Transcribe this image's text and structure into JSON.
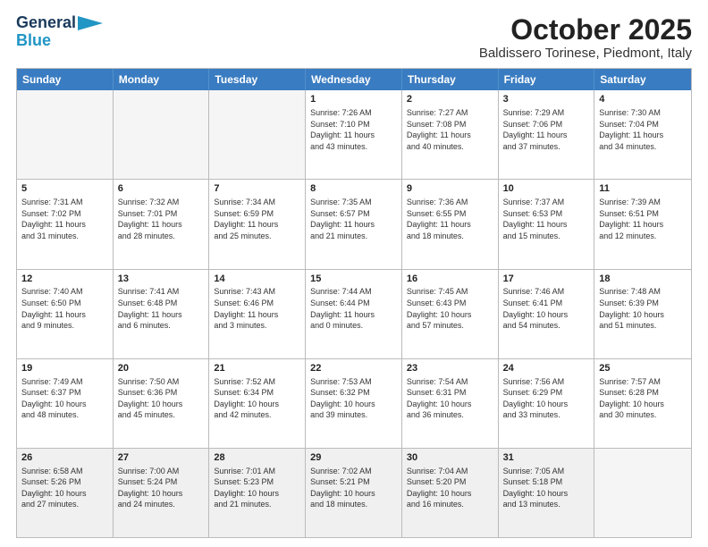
{
  "logo": {
    "general": "General",
    "blue": "Blue"
  },
  "header": {
    "month": "October 2025",
    "location": "Baldissero Torinese, Piedmont, Italy"
  },
  "days": [
    "Sunday",
    "Monday",
    "Tuesday",
    "Wednesday",
    "Thursday",
    "Friday",
    "Saturday"
  ],
  "weeks": [
    [
      {
        "day": "",
        "info": ""
      },
      {
        "day": "",
        "info": ""
      },
      {
        "day": "",
        "info": ""
      },
      {
        "day": "1",
        "info": "Sunrise: 7:26 AM\nSunset: 7:10 PM\nDaylight: 11 hours\nand 43 minutes."
      },
      {
        "day": "2",
        "info": "Sunrise: 7:27 AM\nSunset: 7:08 PM\nDaylight: 11 hours\nand 40 minutes."
      },
      {
        "day": "3",
        "info": "Sunrise: 7:29 AM\nSunset: 7:06 PM\nDaylight: 11 hours\nand 37 minutes."
      },
      {
        "day": "4",
        "info": "Sunrise: 7:30 AM\nSunset: 7:04 PM\nDaylight: 11 hours\nand 34 minutes."
      }
    ],
    [
      {
        "day": "5",
        "info": "Sunrise: 7:31 AM\nSunset: 7:02 PM\nDaylight: 11 hours\nand 31 minutes."
      },
      {
        "day": "6",
        "info": "Sunrise: 7:32 AM\nSunset: 7:01 PM\nDaylight: 11 hours\nand 28 minutes."
      },
      {
        "day": "7",
        "info": "Sunrise: 7:34 AM\nSunset: 6:59 PM\nDaylight: 11 hours\nand 25 minutes."
      },
      {
        "day": "8",
        "info": "Sunrise: 7:35 AM\nSunset: 6:57 PM\nDaylight: 11 hours\nand 21 minutes."
      },
      {
        "day": "9",
        "info": "Sunrise: 7:36 AM\nSunset: 6:55 PM\nDaylight: 11 hours\nand 18 minutes."
      },
      {
        "day": "10",
        "info": "Sunrise: 7:37 AM\nSunset: 6:53 PM\nDaylight: 11 hours\nand 15 minutes."
      },
      {
        "day": "11",
        "info": "Sunrise: 7:39 AM\nSunset: 6:51 PM\nDaylight: 11 hours\nand 12 minutes."
      }
    ],
    [
      {
        "day": "12",
        "info": "Sunrise: 7:40 AM\nSunset: 6:50 PM\nDaylight: 11 hours\nand 9 minutes."
      },
      {
        "day": "13",
        "info": "Sunrise: 7:41 AM\nSunset: 6:48 PM\nDaylight: 11 hours\nand 6 minutes."
      },
      {
        "day": "14",
        "info": "Sunrise: 7:43 AM\nSunset: 6:46 PM\nDaylight: 11 hours\nand 3 minutes."
      },
      {
        "day": "15",
        "info": "Sunrise: 7:44 AM\nSunset: 6:44 PM\nDaylight: 11 hours\nand 0 minutes."
      },
      {
        "day": "16",
        "info": "Sunrise: 7:45 AM\nSunset: 6:43 PM\nDaylight: 10 hours\nand 57 minutes."
      },
      {
        "day": "17",
        "info": "Sunrise: 7:46 AM\nSunset: 6:41 PM\nDaylight: 10 hours\nand 54 minutes."
      },
      {
        "day": "18",
        "info": "Sunrise: 7:48 AM\nSunset: 6:39 PM\nDaylight: 10 hours\nand 51 minutes."
      }
    ],
    [
      {
        "day": "19",
        "info": "Sunrise: 7:49 AM\nSunset: 6:37 PM\nDaylight: 10 hours\nand 48 minutes."
      },
      {
        "day": "20",
        "info": "Sunrise: 7:50 AM\nSunset: 6:36 PM\nDaylight: 10 hours\nand 45 minutes."
      },
      {
        "day": "21",
        "info": "Sunrise: 7:52 AM\nSunset: 6:34 PM\nDaylight: 10 hours\nand 42 minutes."
      },
      {
        "day": "22",
        "info": "Sunrise: 7:53 AM\nSunset: 6:32 PM\nDaylight: 10 hours\nand 39 minutes."
      },
      {
        "day": "23",
        "info": "Sunrise: 7:54 AM\nSunset: 6:31 PM\nDaylight: 10 hours\nand 36 minutes."
      },
      {
        "day": "24",
        "info": "Sunrise: 7:56 AM\nSunset: 6:29 PM\nDaylight: 10 hours\nand 33 minutes."
      },
      {
        "day": "25",
        "info": "Sunrise: 7:57 AM\nSunset: 6:28 PM\nDaylight: 10 hours\nand 30 minutes."
      }
    ],
    [
      {
        "day": "26",
        "info": "Sunrise: 6:58 AM\nSunset: 5:26 PM\nDaylight: 10 hours\nand 27 minutes."
      },
      {
        "day": "27",
        "info": "Sunrise: 7:00 AM\nSunset: 5:24 PM\nDaylight: 10 hours\nand 24 minutes."
      },
      {
        "day": "28",
        "info": "Sunrise: 7:01 AM\nSunset: 5:23 PM\nDaylight: 10 hours\nand 21 minutes."
      },
      {
        "day": "29",
        "info": "Sunrise: 7:02 AM\nSunset: 5:21 PM\nDaylight: 10 hours\nand 18 minutes."
      },
      {
        "day": "30",
        "info": "Sunrise: 7:04 AM\nSunset: 5:20 PM\nDaylight: 10 hours\nand 16 minutes."
      },
      {
        "day": "31",
        "info": "Sunrise: 7:05 AM\nSunset: 5:18 PM\nDaylight: 10 hours\nand 13 minutes."
      },
      {
        "day": "",
        "info": ""
      }
    ]
  ]
}
